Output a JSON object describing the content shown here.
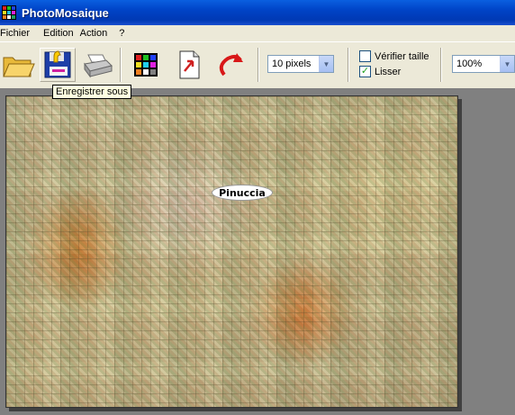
{
  "window": {
    "title": "PhotoMosaique"
  },
  "menu": {
    "items": [
      "Fichier",
      "Edition",
      "Action",
      "?"
    ]
  },
  "toolbar": {
    "buttons": [
      "open-folder-icon",
      "save-floppy-icon",
      "print-icon",
      "color-grid-icon",
      "export-document-icon",
      "undo-arrow-icon"
    ],
    "tile_size": {
      "value": "10 pixels"
    },
    "verify_size": {
      "label": "Vérifier taille",
      "checked": false
    },
    "smooth": {
      "label": "Lisser",
      "checked": true
    },
    "zoom": {
      "value": "100%"
    }
  },
  "tooltip": {
    "text": "Enregistrer sous"
  },
  "image": {
    "watermark": "Pinuccia"
  },
  "colors": {
    "title_bar": "#0043c6",
    "chrome": "#ece9d8",
    "workspace": "#808080",
    "tooltip_bg": "#ffffe1"
  }
}
